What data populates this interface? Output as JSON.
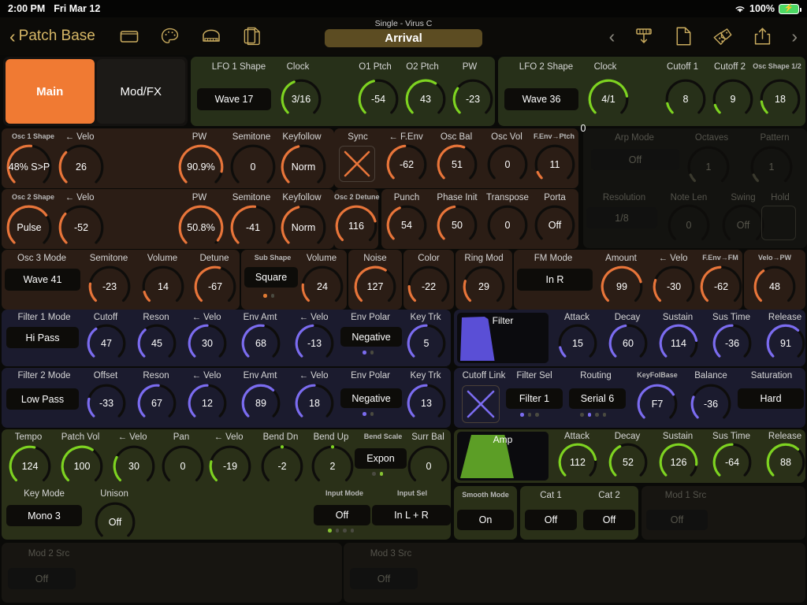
{
  "status": {
    "time": "2:00 PM",
    "date": "Fri Mar 12",
    "battery": "100%",
    "wifi_icon": "wifi-icon",
    "battery_icon": "battery-charging-icon"
  },
  "nav": {
    "back_label": "Patch Base",
    "icons": [
      "window-icon",
      "palette-icon",
      "piano-icon",
      "copy-document-icon"
    ],
    "right_icons": [
      "chevron-left-icon",
      "download-icon",
      "new-document-icon",
      "dice-icon",
      "share-icon",
      "chevron-right-icon"
    ]
  },
  "patch": {
    "subtitle": "Single - Virus C",
    "name": "Arrival"
  },
  "tabs": [
    {
      "label": "Main",
      "active": true
    },
    {
      "label": "Mod/FX",
      "active": false
    }
  ],
  "lfo1": {
    "title_shape": "LFO 1 Shape",
    "shape_value": "Wave 17",
    "knobs": [
      {
        "label": "Clock",
        "value": "3/16",
        "pct": 0.42
      },
      {
        "label": "O1 Ptch",
        "value": "-54",
        "pct": 0.45
      },
      {
        "label": "O2 Ptch",
        "value": "43",
        "pct": 0.62
      },
      {
        "label": "PW",
        "value": "-23",
        "pct": 0.3
      }
    ]
  },
  "lfo2": {
    "title_shape": "LFO 2 Shape",
    "shape_value": "Wave 36",
    "knobs": [
      {
        "label": "Clock",
        "value": "4/1",
        "pct": 0.8
      },
      {
        "label": "Cutoff 1",
        "value": "8",
        "pct": 0.12
      },
      {
        "label": "Cutoff 2",
        "value": "9",
        "pct": 0.1
      },
      {
        "label": "Osc Shape 1/2",
        "value": "18",
        "pct": 0.14,
        "small": true
      }
    ]
  },
  "osc1": {
    "shape_label": "Osc 1 Shape",
    "shape_value": "48% S>P",
    "shape_pct": 0.52,
    "knobs": [
      {
        "label": "← Velo",
        "value": "26",
        "pct": 0.33
      },
      {
        "label": "PW",
        "value": "90.9%",
        "pct": 0.88
      },
      {
        "label": "Semitone",
        "value": "0",
        "pct": 0.0
      },
      {
        "label": "Keyfollow",
        "value": "Norm",
        "pct": 0.45
      }
    ]
  },
  "sync_section": {
    "sync_label": "Sync",
    "sync_state": "on",
    "knobs": [
      {
        "label": "← F.Env",
        "value": "-62",
        "pct": 0.48
      },
      {
        "label": "Osc Bal",
        "value": "51",
        "pct": 0.58
      },
      {
        "label": "Osc Vol",
        "value": "0",
        "pct": 0.0
      },
      {
        "label": "F.Env→Ptch",
        "value": "11",
        "pct": 0.08,
        "small": true
      }
    ]
  },
  "arp": {
    "mode_label": "Arp Mode",
    "mode_value": "Off",
    "octaves_label": "Octaves",
    "octaves_value": "1",
    "pattern_label": "Pattern",
    "pattern_value": "1",
    "resolution_label": "Resolution",
    "resolution_value": "1/8",
    "notelen_label": "Note Len",
    "notelen_value": "0",
    "swing_label": "Swing",
    "swing_value": "Off",
    "hold_label": "Hold",
    "hold_state": "off"
  },
  "osc2": {
    "shape_label": "Osc 2 Shape",
    "shape_value": "Pulse",
    "shape_pct": 0.7,
    "knobs": [
      {
        "label": "← Velo",
        "value": "-52",
        "pct": 0.32
      },
      {
        "label": "PW",
        "value": "50.8%",
        "pct": 0.97
      },
      {
        "label": "Semitone",
        "value": "-41",
        "pct": 0.52
      },
      {
        "label": "Keyfollow",
        "value": "Norm",
        "pct": 0.45
      }
    ]
  },
  "detune_section": {
    "detune_label": "Osc 2 Detune",
    "detune_value": "116",
    "detune_pct": 0.78,
    "knobs": [
      {
        "label": "Punch",
        "value": "54",
        "pct": 0.42
      },
      {
        "label": "Phase Init",
        "value": "50",
        "pct": 0.47
      },
      {
        "label": "Transpose",
        "value": "0",
        "pct": 0.0
      },
      {
        "label": "Porta",
        "value": "Off",
        "pct": 0.0
      }
    ]
  },
  "osc3": {
    "mode_label": "Osc 3 Mode",
    "mode_value": "Wave 41",
    "knobs": [
      {
        "label": "Semitone",
        "value": "-23",
        "pct": 0.2
      },
      {
        "label": "Volume",
        "value": "14",
        "pct": 0.11
      },
      {
        "label": "Detune",
        "value": "-67",
        "pct": 0.55
      }
    ]
  },
  "sub": {
    "shape_label": "Sub Shape",
    "shape_value": "Square",
    "volume_label": "Volume",
    "volume_value": "24",
    "volume_pct": 0.19,
    "dots": [
      true,
      false
    ]
  },
  "noise": {
    "label": "Noise",
    "value": "127",
    "pct": 0.62
  },
  "color": {
    "label": "Color",
    "value": "-22",
    "pct": 0.17
  },
  "ringmod": {
    "label": "Ring Mod",
    "value": "29",
    "pct": 0.23
  },
  "fm": {
    "mode_label": "FM Mode",
    "mode_value": "In R",
    "knobs": [
      {
        "label": "Amount",
        "value": "99",
        "pct": 0.78
      },
      {
        "label": "← Velo",
        "value": "-30",
        "pct": 0.24
      },
      {
        "label": "F.Env→FM",
        "value": "-62",
        "pct": 0.49,
        "small": true
      }
    ]
  },
  "velopw": {
    "label": "Velo→PW",
    "value": "48",
    "pct": 0.37,
    "small": true
  },
  "filter1": {
    "mode_label": "Filter 1 Mode",
    "mode_value": "Hi Pass",
    "knobs": [
      {
        "label": "Cutoff",
        "value": "47",
        "pct": 0.37
      },
      {
        "label": "Reson",
        "value": "45",
        "pct": 0.35
      },
      {
        "label": "← Velo",
        "value": "30",
        "pct": 0.5
      },
      {
        "label": "Env Amt",
        "value": "68",
        "pct": 0.53
      },
      {
        "label": "← Velo",
        "value": "-13",
        "pct": 0.48
      }
    ],
    "polar_label": "Env Polar",
    "polar_value": "Negative",
    "keytrk_label": "Key Trk",
    "keytrk_value": "5",
    "keytrk_pct": 0.5,
    "dots": [
      true,
      false
    ]
  },
  "filter_env": {
    "title": "Filter",
    "knobs": [
      {
        "label": "Attack",
        "value": "15",
        "pct": 0.12
      },
      {
        "label": "Decay",
        "value": "60",
        "pct": 0.47
      },
      {
        "label": "Sustain",
        "value": "114",
        "pct": 0.8
      },
      {
        "label": "Sus Time",
        "value": "-36",
        "pct": 0.5
      },
      {
        "label": "Release",
        "value": "91",
        "pct": 0.66
      }
    ]
  },
  "filter2": {
    "mode_label": "Filter 2 Mode",
    "mode_value": "Low Pass",
    "knobs": [
      {
        "label": "Offset",
        "value": "-33",
        "pct": 0.22
      },
      {
        "label": "Reson",
        "value": "67",
        "pct": 0.52
      },
      {
        "label": "← Velo",
        "value": "12",
        "pct": 0.5
      },
      {
        "label": "Env Amt",
        "value": "89",
        "pct": 0.66
      },
      {
        "label": "← Velo",
        "value": "18",
        "pct": 0.5
      }
    ],
    "polar_label": "Env Polar",
    "polar_value": "Negative",
    "keytrk_label": "Key Trk",
    "keytrk_value": "13",
    "keytrk_pct": 0.5,
    "dots": [
      true,
      false
    ]
  },
  "filter_routing": {
    "cutoff_link_label": "Cutoff Link",
    "cutoff_link_state": "on",
    "filter_sel_label": "Filter Sel",
    "filter_sel_value": "Filter 1",
    "filter_sel_dots": [
      true,
      false,
      false
    ],
    "routing_label": "Routing",
    "routing_value": "Serial 6",
    "routing_dots": [
      false,
      true,
      false,
      false
    ],
    "keyfolbase_label": "KeyFolBase",
    "keyfolbase_value": "F7",
    "keyfolbase_pct": 0.72,
    "balance_label": "Balance",
    "balance_value": "-36",
    "balance_pct": 0.25,
    "saturation_label": "Saturation",
    "saturation_value": "Hard"
  },
  "perf": {
    "knobs": [
      {
        "label": "Tempo",
        "value": "124",
        "pct": 0.55
      },
      {
        "label": "Patch Vol",
        "value": "100",
        "pct": 0.62
      },
      {
        "label": "← Velo",
        "value": "30",
        "pct": 0.27
      },
      {
        "label": "Pan",
        "value": "0",
        "pct": 0.0
      },
      {
        "label": "← Velo",
        "value": "-19",
        "pct": 0.22
      },
      {
        "label": "Bend Dn",
        "value": "-2",
        "pct": 0.5,
        "dot": true
      },
      {
        "label": "Bend Up",
        "value": "2",
        "pct": 0.5,
        "dot": true
      }
    ],
    "bend_scale_label": "Bend Scale",
    "bend_scale_value": "Expon",
    "bend_scale_dots": [
      false,
      true
    ],
    "surr_label": "Surr Bal",
    "surr_value": "0",
    "surr_pct": 0.0
  },
  "amp_env": {
    "title": "Amp",
    "knobs": [
      {
        "label": "Attack",
        "value": "112",
        "pct": 0.8
      },
      {
        "label": "Decay",
        "value": "52",
        "pct": 0.4
      },
      {
        "label": "Sustain",
        "value": "126",
        "pct": 0.86
      },
      {
        "label": "Sus Time",
        "value": "-64",
        "pct": 0.5
      },
      {
        "label": "Release",
        "value": "88",
        "pct": 0.66
      }
    ]
  },
  "voice": {
    "keymode_label": "Key Mode",
    "keymode_value": "Mono 3",
    "unison_label": "Unison",
    "unison_value": "Off",
    "unison_pct": 0.0,
    "inputmode_label": "Input Mode",
    "inputmode_value": "Off",
    "inputsel_label": "Input Sel",
    "inputsel_value": "In L + R",
    "dots": [
      true,
      false,
      false,
      false
    ]
  },
  "smooth": {
    "label": "Smooth Mode",
    "value": "On"
  },
  "cat": {
    "cat1_label": "Cat 1",
    "cat1_value": "Off",
    "cat2_label": "Cat 2",
    "cat2_value": "Off"
  },
  "mod1": {
    "label": "Mod 1 Src",
    "value": "Off"
  },
  "mod2": {
    "label": "Mod 2 Src",
    "value": "Off"
  },
  "mod3": {
    "label": "Mod 3 Src",
    "value": "Off"
  },
  "colors": {
    "orange": "#e8753a",
    "green": "#7ed321",
    "blue": "#7b6cf0",
    "gold": "#c9ab5e",
    "track": "#121210"
  }
}
